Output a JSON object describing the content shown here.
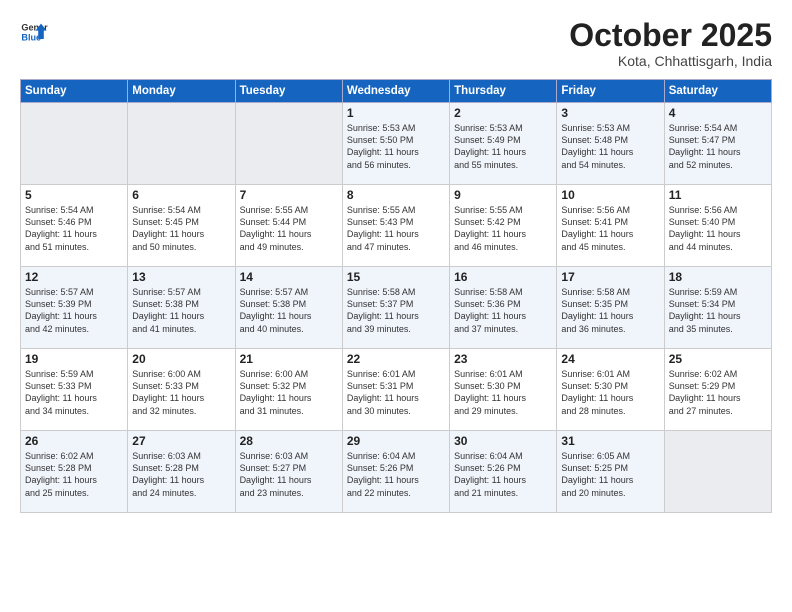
{
  "header": {
    "logo_general": "General",
    "logo_blue": "Blue",
    "month": "October 2025",
    "location": "Kota, Chhattisgarh, India"
  },
  "weekdays": [
    "Sunday",
    "Monday",
    "Tuesday",
    "Wednesday",
    "Thursday",
    "Friday",
    "Saturday"
  ],
  "weeks": [
    [
      {
        "day": "",
        "info": ""
      },
      {
        "day": "",
        "info": ""
      },
      {
        "day": "",
        "info": ""
      },
      {
        "day": "1",
        "info": "Sunrise: 5:53 AM\nSunset: 5:50 PM\nDaylight: 11 hours\nand 56 minutes."
      },
      {
        "day": "2",
        "info": "Sunrise: 5:53 AM\nSunset: 5:49 PM\nDaylight: 11 hours\nand 55 minutes."
      },
      {
        "day": "3",
        "info": "Sunrise: 5:53 AM\nSunset: 5:48 PM\nDaylight: 11 hours\nand 54 minutes."
      },
      {
        "day": "4",
        "info": "Sunrise: 5:54 AM\nSunset: 5:47 PM\nDaylight: 11 hours\nand 52 minutes."
      }
    ],
    [
      {
        "day": "5",
        "info": "Sunrise: 5:54 AM\nSunset: 5:46 PM\nDaylight: 11 hours\nand 51 minutes."
      },
      {
        "day": "6",
        "info": "Sunrise: 5:54 AM\nSunset: 5:45 PM\nDaylight: 11 hours\nand 50 minutes."
      },
      {
        "day": "7",
        "info": "Sunrise: 5:55 AM\nSunset: 5:44 PM\nDaylight: 11 hours\nand 49 minutes."
      },
      {
        "day": "8",
        "info": "Sunrise: 5:55 AM\nSunset: 5:43 PM\nDaylight: 11 hours\nand 47 minutes."
      },
      {
        "day": "9",
        "info": "Sunrise: 5:55 AM\nSunset: 5:42 PM\nDaylight: 11 hours\nand 46 minutes."
      },
      {
        "day": "10",
        "info": "Sunrise: 5:56 AM\nSunset: 5:41 PM\nDaylight: 11 hours\nand 45 minutes."
      },
      {
        "day": "11",
        "info": "Sunrise: 5:56 AM\nSunset: 5:40 PM\nDaylight: 11 hours\nand 44 minutes."
      }
    ],
    [
      {
        "day": "12",
        "info": "Sunrise: 5:57 AM\nSunset: 5:39 PM\nDaylight: 11 hours\nand 42 minutes."
      },
      {
        "day": "13",
        "info": "Sunrise: 5:57 AM\nSunset: 5:38 PM\nDaylight: 11 hours\nand 41 minutes."
      },
      {
        "day": "14",
        "info": "Sunrise: 5:57 AM\nSunset: 5:38 PM\nDaylight: 11 hours\nand 40 minutes."
      },
      {
        "day": "15",
        "info": "Sunrise: 5:58 AM\nSunset: 5:37 PM\nDaylight: 11 hours\nand 39 minutes."
      },
      {
        "day": "16",
        "info": "Sunrise: 5:58 AM\nSunset: 5:36 PM\nDaylight: 11 hours\nand 37 minutes."
      },
      {
        "day": "17",
        "info": "Sunrise: 5:58 AM\nSunset: 5:35 PM\nDaylight: 11 hours\nand 36 minutes."
      },
      {
        "day": "18",
        "info": "Sunrise: 5:59 AM\nSunset: 5:34 PM\nDaylight: 11 hours\nand 35 minutes."
      }
    ],
    [
      {
        "day": "19",
        "info": "Sunrise: 5:59 AM\nSunset: 5:33 PM\nDaylight: 11 hours\nand 34 minutes."
      },
      {
        "day": "20",
        "info": "Sunrise: 6:00 AM\nSunset: 5:33 PM\nDaylight: 11 hours\nand 32 minutes."
      },
      {
        "day": "21",
        "info": "Sunrise: 6:00 AM\nSunset: 5:32 PM\nDaylight: 11 hours\nand 31 minutes."
      },
      {
        "day": "22",
        "info": "Sunrise: 6:01 AM\nSunset: 5:31 PM\nDaylight: 11 hours\nand 30 minutes."
      },
      {
        "day": "23",
        "info": "Sunrise: 6:01 AM\nSunset: 5:30 PM\nDaylight: 11 hours\nand 29 minutes."
      },
      {
        "day": "24",
        "info": "Sunrise: 6:01 AM\nSunset: 5:30 PM\nDaylight: 11 hours\nand 28 minutes."
      },
      {
        "day": "25",
        "info": "Sunrise: 6:02 AM\nSunset: 5:29 PM\nDaylight: 11 hours\nand 27 minutes."
      }
    ],
    [
      {
        "day": "26",
        "info": "Sunrise: 6:02 AM\nSunset: 5:28 PM\nDaylight: 11 hours\nand 25 minutes."
      },
      {
        "day": "27",
        "info": "Sunrise: 6:03 AM\nSunset: 5:28 PM\nDaylight: 11 hours\nand 24 minutes."
      },
      {
        "day": "28",
        "info": "Sunrise: 6:03 AM\nSunset: 5:27 PM\nDaylight: 11 hours\nand 23 minutes."
      },
      {
        "day": "29",
        "info": "Sunrise: 6:04 AM\nSunset: 5:26 PM\nDaylight: 11 hours\nand 22 minutes."
      },
      {
        "day": "30",
        "info": "Sunrise: 6:04 AM\nSunset: 5:26 PM\nDaylight: 11 hours\nand 21 minutes."
      },
      {
        "day": "31",
        "info": "Sunrise: 6:05 AM\nSunset: 5:25 PM\nDaylight: 11 hours\nand 20 minutes."
      },
      {
        "day": "",
        "info": ""
      }
    ]
  ]
}
